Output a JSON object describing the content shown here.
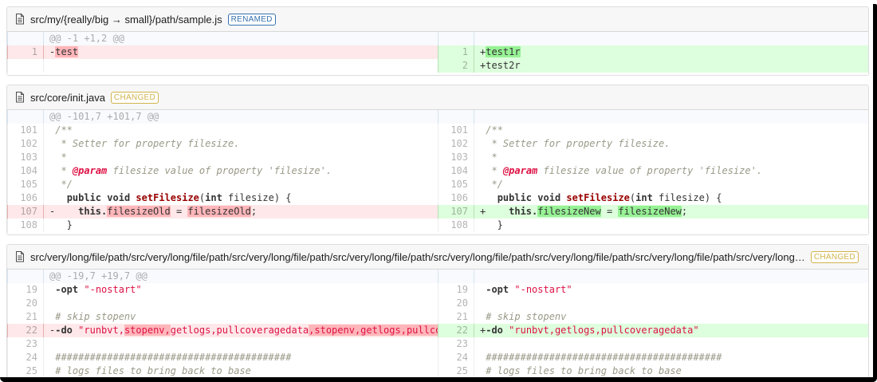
{
  "colors": {
    "renamed_badge": "#3572b0",
    "changed_badge": "#d0b44c",
    "del_line_bg": "#fee8e9",
    "del_word_bg": "#ffb6ba",
    "ins_line_bg": "#ddffdd",
    "ins_word_bg": "#97f295",
    "hunk_bg": "#f8fafd",
    "string_text": "#dd1144",
    "comment_text": "#999988",
    "function_name_text": "#990000"
  },
  "files": [
    {
      "name": "src/my/{really/big → small}/path/sample.js",
      "badge": {
        "label": "RENAMED",
        "color": "#3572b0"
      },
      "rows": [
        {
          "l": {
            "type": "info",
            "text": "@@ -1 +1,2 @@"
          },
          "r": {
            "type": "info",
            "text": ""
          }
        },
        {
          "l": {
            "type": "del",
            "num": "1",
            "seg": [
              [
                "-",
                ""
              ],
              [
                "test",
                "hl"
              ]
            ]
          },
          "r": {
            "type": "ins",
            "num": "1",
            "seg": [
              [
                "+",
                ""
              ],
              [
                "test1r",
                "hl"
              ]
            ]
          }
        },
        {
          "l": {
            "type": "empty"
          },
          "r": {
            "type": "ins",
            "num": "2",
            "seg": [
              [
                "+test2r",
                ""
              ]
            ]
          }
        }
      ]
    },
    {
      "name": "src/core/init.java",
      "badge": {
        "label": "CHANGED",
        "color": "#d0b44c"
      },
      "rows": [
        {
          "l": {
            "type": "info",
            "text": "@@ -101,7 +101,7 @@"
          },
          "r": {
            "type": "info",
            "text": ""
          }
        },
        {
          "c": {
            "num": "101",
            "seg": [
              [
                " ",
                ""
              ],
              [
                "/**",
                "c"
              ]
            ]
          }
        },
        {
          "c": {
            "num": "102",
            "seg": [
              [
                " ",
                ""
              ],
              [
                " * Setter for property filesize.",
                "c"
              ]
            ]
          }
        },
        {
          "c": {
            "num": "103",
            "seg": [
              [
                " ",
                ""
              ],
              [
                " *",
                "c"
              ]
            ]
          }
        },
        {
          "c": {
            "num": "104",
            "seg": [
              [
                " ",
                ""
              ],
              [
                " * ",
                "c"
              ],
              [
                "@param",
                "d"
              ],
              [
                " filesize value of property 'filesize'.",
                "c"
              ]
            ]
          }
        },
        {
          "c": {
            "num": "105",
            "seg": [
              [
                " ",
                ""
              ],
              [
                " */",
                "c"
              ]
            ]
          }
        },
        {
          "c": {
            "num": "106",
            "seg": [
              [
                "   ",
                ""
              ],
              [
                "public",
                "k"
              ],
              [
                " ",
                ""
              ],
              [
                "void",
                "k"
              ],
              [
                " ",
                ""
              ],
              [
                "setFilesize",
                "t"
              ],
              [
                "(",
                ""
              ],
              [
                "int",
                "k"
              ],
              [
                " filesize) {",
                ""
              ]
            ]
          }
        },
        {
          "l": {
            "type": "del",
            "num": "107",
            "seg": [
              [
                "-    ",
                ""
              ],
              [
                "this.",
                "k"
              ],
              [
                "filesizeOld",
                "hl"
              ],
              [
                " = ",
                ""
              ],
              [
                "filesizeOld",
                "hl"
              ],
              [
                ";",
                ""
              ]
            ]
          },
          "r": {
            "type": "ins",
            "num": "107",
            "seg": [
              [
                "+    ",
                ""
              ],
              [
                "this.",
                "k"
              ],
              [
                "filesizeNew",
                "hl"
              ],
              [
                " = ",
                ""
              ],
              [
                "filesizeNew",
                "hl"
              ],
              [
                ";",
                ""
              ]
            ]
          }
        },
        {
          "c": {
            "num": "108",
            "seg": [
              [
                "   }",
                ""
              ]
            ]
          }
        }
      ]
    },
    {
      "name": "src/very/long/file/path/src/very/long/file/path/src/very/long/file/path/src/very/long/file/path/src/very/long/file/path/src/very/long/file/path/src/very/long/file/path/src/very/long…",
      "badge": {
        "label": "CHANGED",
        "color": "#d0b44c"
      },
      "rows": [
        {
          "l": {
            "type": "info",
            "text": "@@ -19,7 +19,7 @@"
          },
          "r": {
            "type": "info",
            "text": ""
          }
        },
        {
          "c": {
            "num": "19",
            "seg": [
              [
                " ",
                ""
              ],
              [
                "-opt",
                "k"
              ],
              [
                " ",
                ""
              ],
              [
                "\"-nostart\"",
                "s"
              ]
            ]
          }
        },
        {
          "c": {
            "num": "20",
            "seg": []
          }
        },
        {
          "c": {
            "num": "21",
            "seg": [
              [
                " ",
                ""
              ],
              [
                "# skip stopenv",
                "c"
              ]
            ]
          }
        },
        {
          "l": {
            "type": "del",
            "num": "22",
            "seg": [
              [
                "-",
                ""
              ],
              [
                "-do",
                "k"
              ],
              [
                " ",
                ""
              ],
              [
                "\"runbvt,",
                "s"
              ],
              [
                "stopenv,",
                "s hl"
              ],
              [
                "getlogs,pullcoveragedata",
                "s"
              ],
              [
                ",stopenv,getlogs,pullcoveragedata\"",
                "s hl"
              ]
            ]
          },
          "r": {
            "type": "ins",
            "num": "22",
            "seg": [
              [
                "+",
                ""
              ],
              [
                "-do",
                "k"
              ],
              [
                " ",
                ""
              ],
              [
                "\"runbvt,getlogs,pullcoveragedata\"",
                "s"
              ]
            ]
          }
        },
        {
          "c": {
            "num": "23",
            "seg": []
          }
        },
        {
          "c": {
            "num": "24",
            "seg": [
              [
                " ",
                ""
              ],
              [
                "#########################################",
                "c"
              ]
            ]
          }
        },
        {
          "c": {
            "num": "25",
            "seg": [
              [
                " ",
                ""
              ],
              [
                "# logs files to bring back to base",
                "c"
              ]
            ]
          }
        }
      ]
    }
  ]
}
